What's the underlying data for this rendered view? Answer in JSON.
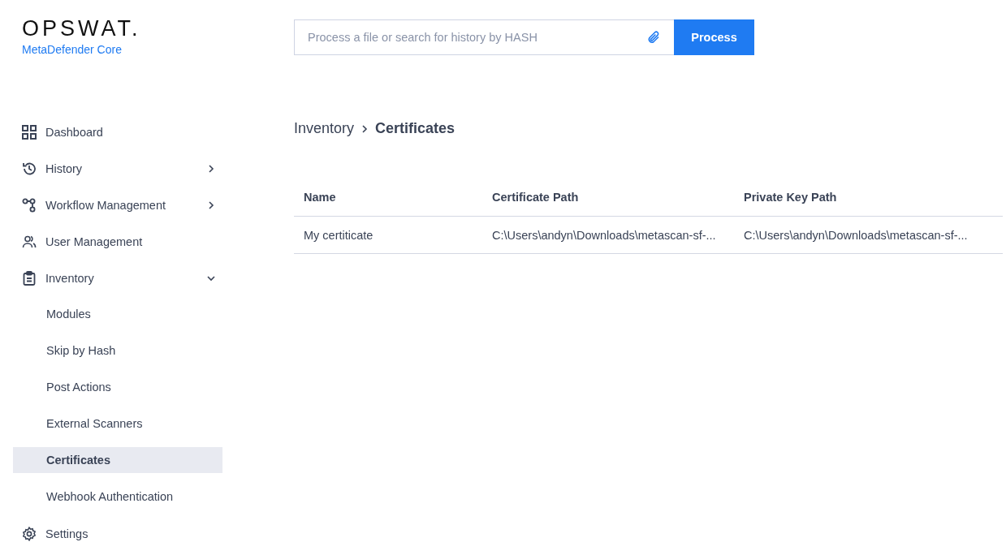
{
  "logo": {
    "wordmark": "OPSWAT.",
    "product": "MetaDefender Core"
  },
  "search": {
    "placeholder": "Process a file or search for history by HASH",
    "button": "Process"
  },
  "sidebar": {
    "items": [
      {
        "label": "Dashboard",
        "selected": false
      },
      {
        "label": "History",
        "selected": false,
        "expanded": false
      },
      {
        "label": "Workflow Management",
        "selected": false,
        "expanded": false
      },
      {
        "label": "User Management",
        "selected": false
      },
      {
        "label": "Inventory",
        "selected": false,
        "expanded": true,
        "children": [
          {
            "label": "Modules",
            "selected": false
          },
          {
            "label": "Skip by Hash",
            "selected": false
          },
          {
            "label": "Post Actions",
            "selected": false
          },
          {
            "label": "External Scanners",
            "selected": false
          },
          {
            "label": "Certificates",
            "selected": true
          },
          {
            "label": "Webhook Authentication",
            "selected": false
          }
        ]
      },
      {
        "label": "Settings",
        "selected": false
      }
    ]
  },
  "breadcrumb": [
    "Inventory",
    "Certificates"
  ],
  "table": {
    "columns": [
      "Name",
      "Certificate Path",
      "Private Key Path"
    ],
    "rows": [
      [
        "My certiticate",
        "C:\\Users\\andyn\\Downloads\\metascan-sf-...",
        "C:\\Users\\andyn\\Downloads\\metascan-sf-..."
      ]
    ]
  }
}
